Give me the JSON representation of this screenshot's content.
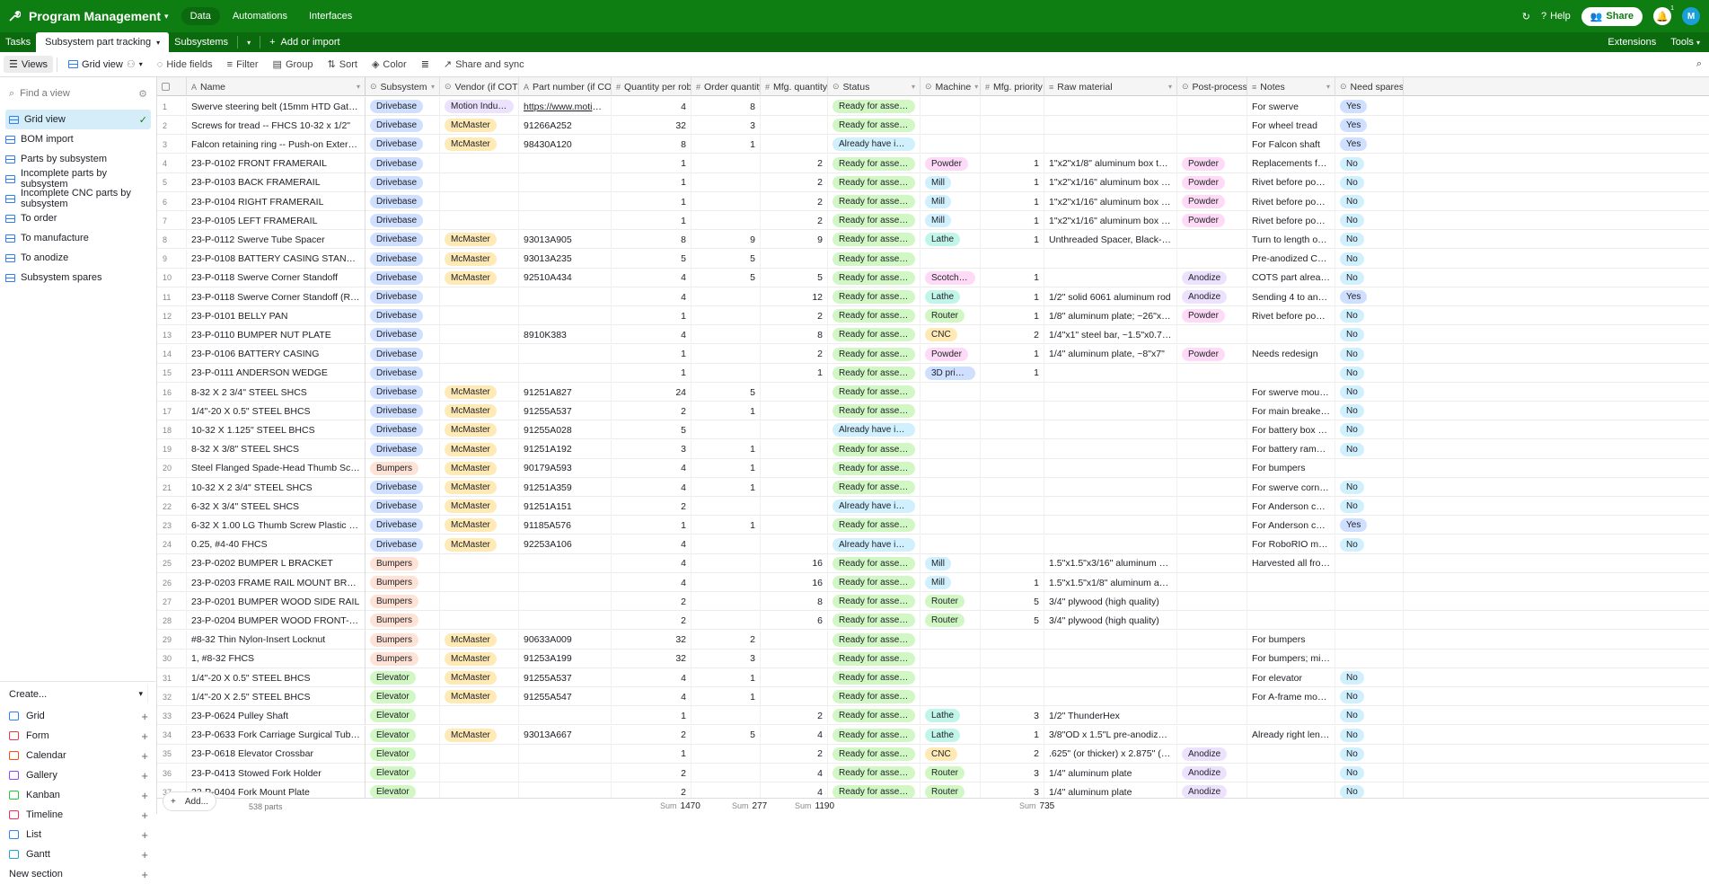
{
  "topbar": {
    "base_name": "Program Management",
    "tabs": [
      "Data",
      "Automations",
      "Interfaces"
    ],
    "active_tab": "Data",
    "help": "Help",
    "share": "Share",
    "avatar": "M",
    "notification_count": "1",
    "colors": {
      "bar": "#0e7d12",
      "accent": "#1aa0d8"
    }
  },
  "tablebar": {
    "tables": [
      "Tasks",
      "Subsystem part tracking",
      "Subsystems"
    ],
    "active": "Subsystem part tracking",
    "add_import": "Add or import",
    "extensions": "Extensions",
    "tools": "Tools"
  },
  "viewbar": {
    "views": "Views",
    "grid_view": "Grid view",
    "hide_fields": "Hide fields",
    "filter": "Filter",
    "group": "Group",
    "sort": "Sort",
    "color": "Color",
    "share_sync": "Share and sync"
  },
  "sidebar": {
    "find_placeholder": "Find a view",
    "views": [
      "Grid view",
      "BOM import",
      "Parts by subsystem",
      "Incomplete parts by subsystem",
      "Incomplete CNC parts by subsystem",
      "To order",
      "To manufacture",
      "To anodize",
      "Subsystem spares"
    ],
    "active_view": "Grid view",
    "create_label": "Create...",
    "create_items": [
      {
        "label": "Grid",
        "color": "#2d7ff9"
      },
      {
        "label": "Form",
        "color": "#e8384f"
      },
      {
        "label": "Calendar",
        "color": "#f04f12"
      },
      {
        "label": "Gallery",
        "color": "#8b46ff"
      },
      {
        "label": "Kanban",
        "color": "#20c933"
      },
      {
        "label": "Timeline",
        "color": "#f82b60"
      },
      {
        "label": "List",
        "color": "#2d7ff9"
      },
      {
        "label": "Gantt",
        "color": "#20a0d9"
      }
    ],
    "new_section": "New section"
  },
  "grid": {
    "columns": [
      "Name",
      "Subsystem",
      "Vendor (if COTS)",
      "Part number (if COTS)",
      "Quantity per robot",
      "Order quantity",
      "Mfg. quantity",
      "Status",
      "Machine",
      "Mfg. priority",
      "Raw material",
      "Post-process",
      "Notes",
      "Need spares?"
    ],
    "rows": [
      [
        "1",
        "Swerve steering belt (15mm HTD Gates)",
        "Drivebase",
        "Motion Industries",
        "https://www.motionindustri...",
        "4",
        "8",
        "",
        "Ready for assembly",
        "",
        "",
        "",
        "",
        "For swerve",
        "Yes"
      ],
      [
        "2",
        "Screws for tread -- FHCS 10-32 x 1/2\"",
        "Drivebase",
        "McMaster",
        "91266A252",
        "32",
        "3",
        "",
        "Ready for assembly",
        "",
        "",
        "",
        "",
        "For wheel tread",
        "Yes"
      ],
      [
        "3",
        "Falcon retaining ring -- Push-on External Retaining Rings for 1/4\" ...",
        "Drivebase",
        "McMaster",
        "98430A120",
        "8",
        "1",
        "",
        "Already have in general la...",
        "",
        "",
        "",
        "",
        "For Falcon shaft",
        "Yes"
      ],
      [
        "4",
        "23-P-0102 FRONT FRAMERAIL",
        "Drivebase",
        "",
        "",
        "1",
        "",
        "2",
        "Ready for assembly",
        "Powder",
        "1",
        "1\"x2\"x1/8\" aluminum box tubing, ~18\"L",
        "Powder",
        "Replacements for bent rail",
        "No"
      ],
      [
        "5",
        "23-P-0103 BACK FRAMERAIL",
        "Drivebase",
        "",
        "",
        "1",
        "",
        "2",
        "Ready for assembly",
        "Mill",
        "1",
        "1\"x2\"x1/16\" aluminum box tubing, ~18\"L",
        "Powder",
        "Rivet before powder",
        "No"
      ],
      [
        "6",
        "23-P-0104 RIGHT FRAMERAIL",
        "Drivebase",
        "",
        "",
        "1",
        "",
        "2",
        "Ready for assembly",
        "Mill",
        "1",
        "1\"x2\"x1/16\" aluminum box tubing, ~18\"L",
        "Powder",
        "Rivet before powder",
        "No"
      ],
      [
        "7",
        "23-P-0105 LEFT FRAMERAIL",
        "Drivebase",
        "",
        "",
        "1",
        "",
        "2",
        "Ready for assembly",
        "Mill",
        "1",
        "1\"x2\"x1/16\" aluminum box tubing, ~18\"L",
        "Powder",
        "Rivet before powder",
        "No"
      ],
      [
        "8",
        "23-P-0112 Swerve Tube Spacer",
        "Drivebase",
        "McMaster",
        "93013A905",
        "8",
        "9",
        "9",
        "Ready for assembly",
        "Lathe",
        "1",
        "Unthreaded Spacer, Black-Anodized Alumi...",
        "",
        "Turn to length only Reuse l...",
        "No"
      ],
      [
        "9",
        "23-P-0108 BATTERY CASING STANDOFFS",
        "Drivebase",
        "McMaster",
        "93013A235",
        "5",
        "5",
        "",
        "Ready for assembly",
        "",
        "",
        "",
        "",
        "Pre-anodized COTS part Re...",
        "No"
      ],
      [
        "10",
        "23-P-0118 Swerve Corner Standoff",
        "Drivebase",
        "McMaster",
        "92510A434",
        "4",
        "5",
        "5",
        "Ready for assembly",
        "Scotch-Brite",
        "1",
        "",
        "Anodize",
        "COTS part already right len...",
        "No"
      ],
      [
        "11",
        "23-P-0118 Swerve Corner Standoff (Rev 2)",
        "Drivebase",
        "",
        "",
        "4",
        "",
        "12",
        "Ready for assembly",
        "Lathe",
        "1",
        "1/2\" solid 6061 aluminum rod",
        "Anodize",
        "Sending 4 to anodize",
        "Yes"
      ],
      [
        "12",
        "23-P-0101 BELLY PAN",
        "Drivebase",
        "",
        "",
        "1",
        "",
        "2",
        "Ready for assembly",
        "Router",
        "1",
        "1/8\" aluminum plate; ~26\"x26\"",
        "Powder",
        "Rivet before powder",
        "No"
      ],
      [
        "13",
        "23-P-0110 BUMPER NUT PLATE",
        "Drivebase",
        "",
        "8910K383",
        "4",
        "",
        "8",
        "Ready for assembly",
        "CNC",
        "2",
        "1/4\"x1\" steel bar, ~1.5\"x0.75\" Material is i...",
        "",
        "",
        "No"
      ],
      [
        "14",
        "23-P-0106 BATTERY CASING",
        "Drivebase",
        "",
        "",
        "1",
        "",
        "2",
        "Ready for assembly",
        "Powder",
        "1",
        "1/4\" aluminum plate, ~8\"x7\"",
        "Powder",
        "Needs redesign",
        "No"
      ],
      [
        "15",
        "23-P-0111 ANDERSON WEDGE",
        "Drivebase",
        "",
        "",
        "1",
        "",
        "1",
        "Ready for assembly",
        "3D printer",
        "1",
        "",
        "",
        "",
        "No"
      ],
      [
        "16",
        "8-32 X 2 3/4\" STEEL SHCS",
        "Drivebase",
        "McMaster",
        "91251A827",
        "24",
        "5",
        "",
        "Ready for assembly",
        "",
        "",
        "",
        "",
        "For swerve mounting",
        "No"
      ],
      [
        "17",
        "1/4\"-20 X 0.5\" STEEL BHCS",
        "Drivebase",
        "McMaster",
        "91255A537",
        "2",
        "1",
        "",
        "Ready for assembly",
        "",
        "",
        "",
        "",
        "For main breaker mounting",
        "No"
      ],
      [
        "18",
        "10-32 X 1.125\" STEEL BHCS",
        "Drivebase",
        "McMaster",
        "91255A028",
        "5",
        "",
        "",
        "Already have in general la...",
        "",
        "",
        "",
        "",
        "For battery box mounting",
        "No"
      ],
      [
        "19",
        "8-32 X 3/8\" STEEL SHCS",
        "Drivebase",
        "McMaster",
        "91251A192",
        "3",
        "1",
        "",
        "Ready for assembly",
        "",
        "",
        "",
        "",
        "For battery ramp mounting",
        "No"
      ],
      [
        "20",
        "Steel Flanged Spade-Head Thumb Screws",
        "Bumpers",
        "McMaster",
        "90179A593",
        "4",
        "1",
        "",
        "Ready for assembly",
        "",
        "",
        "",
        "",
        "For bumpers",
        ""
      ],
      [
        "21",
        "10-32 X 2 3/4\" STEEL SHCS",
        "Drivebase",
        "McMaster",
        "91251A359",
        "4",
        "1",
        "",
        "Ready for assembly",
        "",
        "",
        "",
        "",
        "For swerve corner standoff",
        "No"
      ],
      [
        "22",
        "6-32 X 3/4\" STEEL SHCS",
        "Drivebase",
        "McMaster",
        "91251A151",
        "2",
        "",
        "",
        "Already have in general la...",
        "",
        "",
        "",
        "",
        "For Anderson connector",
        "No"
      ],
      [
        "23",
        "6-32 X 1.00 LG Thumb Screw Plastic Head Red",
        "Drivebase",
        "McMaster",
        "91185A576",
        "1",
        "1",
        "",
        "Ready for assembly",
        "",
        "",
        "",
        "",
        "For Anderson connector",
        "Yes"
      ],
      [
        "24",
        "0.25, #4-40 FHCS",
        "Drivebase",
        "McMaster",
        "92253A106",
        "4",
        "",
        "",
        "Already have in general la...",
        "",
        "",
        "",
        "",
        "For RoboRIO mounting",
        "No"
      ],
      [
        "25",
        "23-P-0202 BUMPER L BRACKET",
        "Bumpers",
        "",
        "",
        "4",
        "",
        "16",
        "Ready for assembly",
        "Mill",
        "",
        "1.5\"x1.5\"x3/16\" aluminum angle",
        "",
        "Harvested all from past years",
        ""
      ],
      [
        "26",
        "23-P-0203 FRAME RAIL MOUNT BRACKET",
        "Bumpers",
        "",
        "",
        "4",
        "",
        "16",
        "Ready for assembly",
        "Mill",
        "1",
        "1.5\"x1.5\"x1/8\" aluminum angle We have o...",
        "",
        "",
        ""
      ],
      [
        "27",
        "23-P-0201 BUMPER WOOD SIDE RAIL",
        "Bumpers",
        "",
        "",
        "2",
        "",
        "8",
        "Ready for assembly",
        "Router",
        "5",
        "3/4\" plywood (high quality)",
        "",
        "",
        ""
      ],
      [
        "28",
        "23-P-0204 BUMPER WOOD FRONT-BACK RAIL",
        "Bumpers",
        "",
        "",
        "2",
        "",
        "6",
        "Ready for assembly",
        "Router",
        "5",
        "3/4\" plywood (high quality)",
        "",
        "",
        ""
      ],
      [
        "29",
        "#8-32 Thin Nylon-Insert Locknut",
        "Bumpers",
        "McMaster",
        "90633A009",
        "32",
        "2",
        "",
        "Ready for assembly",
        "",
        "",
        "",
        "",
        "For bumpers",
        ""
      ],
      [
        "30",
        "1, #8-32 FHCS",
        "Bumpers",
        "McMaster",
        "91253A199",
        "32",
        "3",
        "",
        "Ready for assembly",
        "",
        "",
        "",
        "",
        "For bumpers; middle bracket",
        ""
      ],
      [
        "31",
        "1/4\"-20 X 0.5\" STEEL BHCS",
        "Elevator",
        "McMaster",
        "91255A537",
        "4",
        "1",
        "",
        "Ready for assembly",
        "",
        "",
        "",
        "",
        "For elevator",
        "No"
      ],
      [
        "32",
        "1/4\"-20 X 2.5\" STEEL BHCS",
        "Elevator",
        "McMaster",
        "91255A547",
        "4",
        "1",
        "",
        "Ready for assembly",
        "",
        "",
        "",
        "",
        "For A-frame mounting",
        "No"
      ],
      [
        "33",
        "23-P-0624 Pulley Shaft",
        "Elevator",
        "",
        "",
        "1",
        "",
        "2",
        "Ready for assembly",
        "Lathe",
        "3",
        "1/2\" ThunderHex",
        "",
        "",
        "No"
      ],
      [
        "34",
        "23-P-0633 Fork Carriage Surgical Tubing Standoff",
        "Elevator",
        "McMaster",
        "93013A667",
        "2",
        "5",
        "4",
        "Ready for assembly",
        "Lathe",
        "1",
        "3/8\"OD x 1.5\"L pre-anodized black alumin...",
        "",
        "Already right length: Need ...",
        "No"
      ],
      [
        "35",
        "23-P-0618 Elevator Crossbar",
        "Elevator",
        "",
        "",
        "1",
        "",
        "2",
        "Ready for assembly",
        "CNC",
        "2",
        ".625\" (or thicker) x 2.875\" (or wider) -- we ...",
        "Anodize",
        "",
        "No"
      ],
      [
        "36",
        "23-P-0413 Stowed Fork Holder",
        "Elevator",
        "",
        "",
        "2",
        "",
        "4",
        "Ready for assembly",
        "Router",
        "3",
        "1/4\" aluminum plate",
        "Anodize",
        "",
        "No"
      ],
      [
        "37",
        "23-P-0404 Fork Mount Plate",
        "Elevator",
        "",
        "",
        "2",
        "",
        "4",
        "Ready for assembly",
        "Router",
        "3",
        "1/4\" aluminum plate",
        "Anodize",
        "",
        "No"
      ]
    ]
  },
  "footer": {
    "add_label": "Add...",
    "count": "538 parts",
    "sum_label": "Sum",
    "sums": {
      "qty": "1470",
      "order": "277",
      "mfg": "1190",
      "priority": "735"
    }
  }
}
